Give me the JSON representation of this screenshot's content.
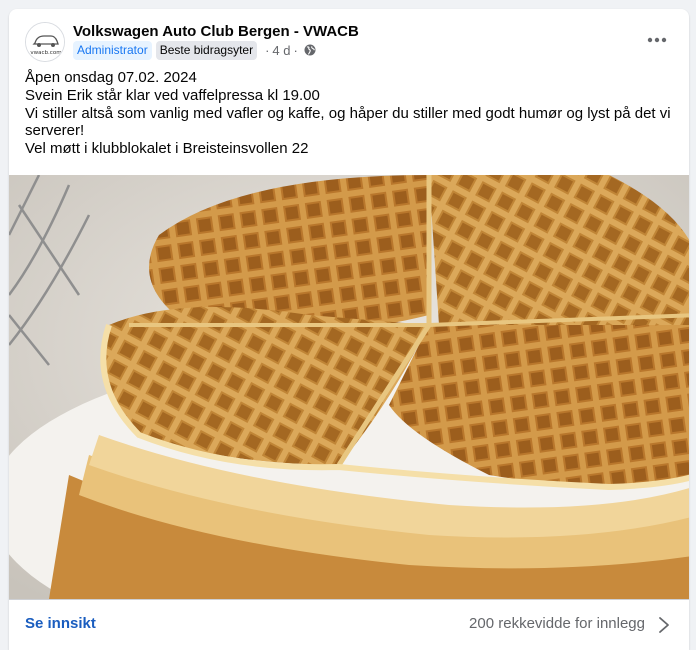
{
  "post": {
    "group_name": "Volkswagen Auto Club Bergen - VWACB",
    "avatar_text": "vwacb.com",
    "badges": {
      "admin": "Administrator",
      "top_contributor": "Beste bidragsyter"
    },
    "time_ago": "4 d",
    "separator": "·",
    "privacy_icon": "globe-icon",
    "more_icon": "more-horizontal-icon",
    "text_lines": [
      "Åpen onsdag 07.02. 2024",
      "Svein Erik står klar ved vaffelpressa kl 19.00",
      "Vi stiller altså som vanlig med vafler og kaffe, og håper du stiller med godt humør og lyst på det vi serverer!",
      "Vel møtt i klubblokalet i Breisteinsvollen 22"
    ],
    "image_subject": "waffles"
  },
  "footer": {
    "insight_label": "Se innsikt",
    "reach_label": "200 rekkevidde for innlegg",
    "chevron_icon": "chevron-right-icon"
  },
  "colors": {
    "accent": "#1877f2",
    "link": "#1a5dbf",
    "secondary_text": "#65676b",
    "background": "#f0f2f5"
  }
}
